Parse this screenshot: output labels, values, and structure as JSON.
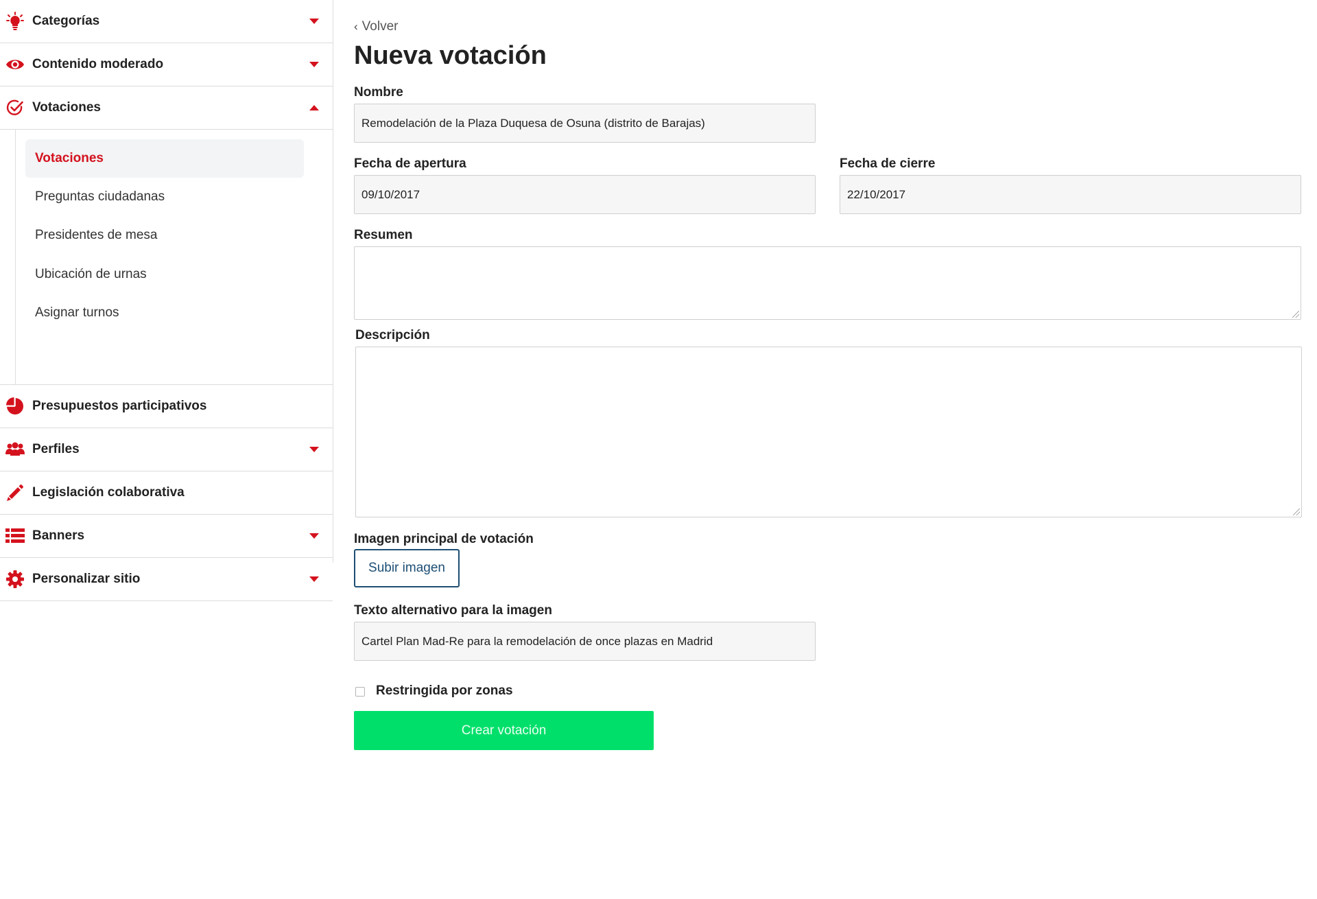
{
  "sidebar": {
    "items": [
      {
        "label": "Categorías",
        "icon": "lightbulb-icon",
        "caret": "down"
      },
      {
        "label": "Contenido moderado",
        "icon": "eye-icon",
        "caret": "down"
      },
      {
        "label": "Votaciones",
        "icon": "check-circle-icon",
        "caret": "up"
      },
      {
        "label": "Presupuestos participativos",
        "icon": "pie-chart-icon"
      },
      {
        "label": "Perfiles",
        "icon": "users-icon",
        "caret": "down"
      },
      {
        "label": "Legislación colaborativa",
        "icon": "pencil-icon"
      },
      {
        "label": "Banners",
        "icon": "list-icon",
        "caret": "down"
      },
      {
        "label": "Personalizar sitio",
        "icon": "gear-icon",
        "caret": "down"
      }
    ],
    "submenu": [
      {
        "label": "Votaciones",
        "active": true
      },
      {
        "label": "Preguntas ciudadanas"
      },
      {
        "label": "Presidentes de mesa"
      },
      {
        "label": "Ubicación de urnas"
      },
      {
        "label": "Asignar turnos"
      }
    ]
  },
  "main": {
    "back_label": "Volver",
    "title": "Nueva votación",
    "form": {
      "name_label": "Nombre",
      "name_value": "Remodelación de la Plaza Duquesa de Osuna (distrito de Barajas)",
      "start_label": "Fecha de apertura",
      "start_value": "09/10/2017",
      "end_label": "Fecha de cierre",
      "end_value": "22/10/2017",
      "summary_label": "Resumen",
      "description_label": "Descripción",
      "image_label": "Imagen principal de votación",
      "upload_label": "Subir imagen",
      "alt_label": "Texto alternativo para la imagen",
      "alt_value": "Cartel Plan Mad-Re para la remodelación de once plazas en Madrid",
      "restricted_label": "Restringida por zonas",
      "restricted_checked": false,
      "submit_label": "Crear votación"
    }
  },
  "colors": {
    "accent": "#d4121e",
    "submit": "#00df6a",
    "upload_border": "#1d4e74"
  }
}
